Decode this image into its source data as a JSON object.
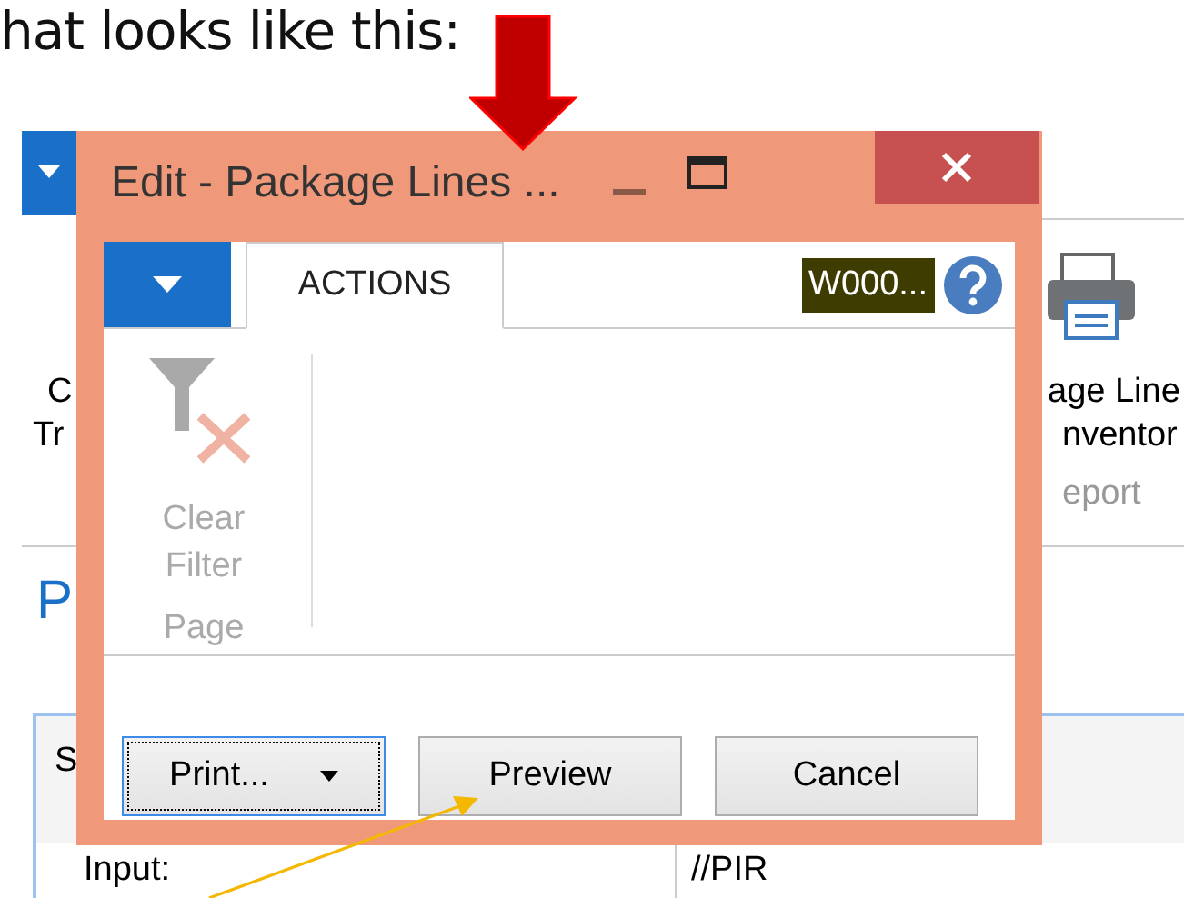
{
  "caption": "hat looks like this:",
  "background_app": {
    "left_labels": [
      "C",
      "Tr"
    ],
    "right_labels": [
      "age Line",
      "nventor"
    ],
    "right_group": "eport",
    "page_title_fragment": "P",
    "table_header_fragment": "S",
    "rows": [
      {
        "label": "Input:",
        "value": "//PIR"
      }
    ]
  },
  "dialog": {
    "title": "Edit - Package Lines ...",
    "tabs": [
      {
        "label": "ACTIONS",
        "selected": true
      }
    ],
    "company_badge": "W000...",
    "ribbon": {
      "actions": [
        {
          "label": "Clear Filter",
          "disabled": true
        }
      ],
      "group": "Page"
    },
    "buttons": [
      {
        "label": "Print...",
        "kind": "split",
        "focused": true
      },
      {
        "label": "Preview",
        "kind": "plain",
        "focused": false
      },
      {
        "label": "Cancel",
        "kind": "plain",
        "focused": false
      }
    ]
  }
}
